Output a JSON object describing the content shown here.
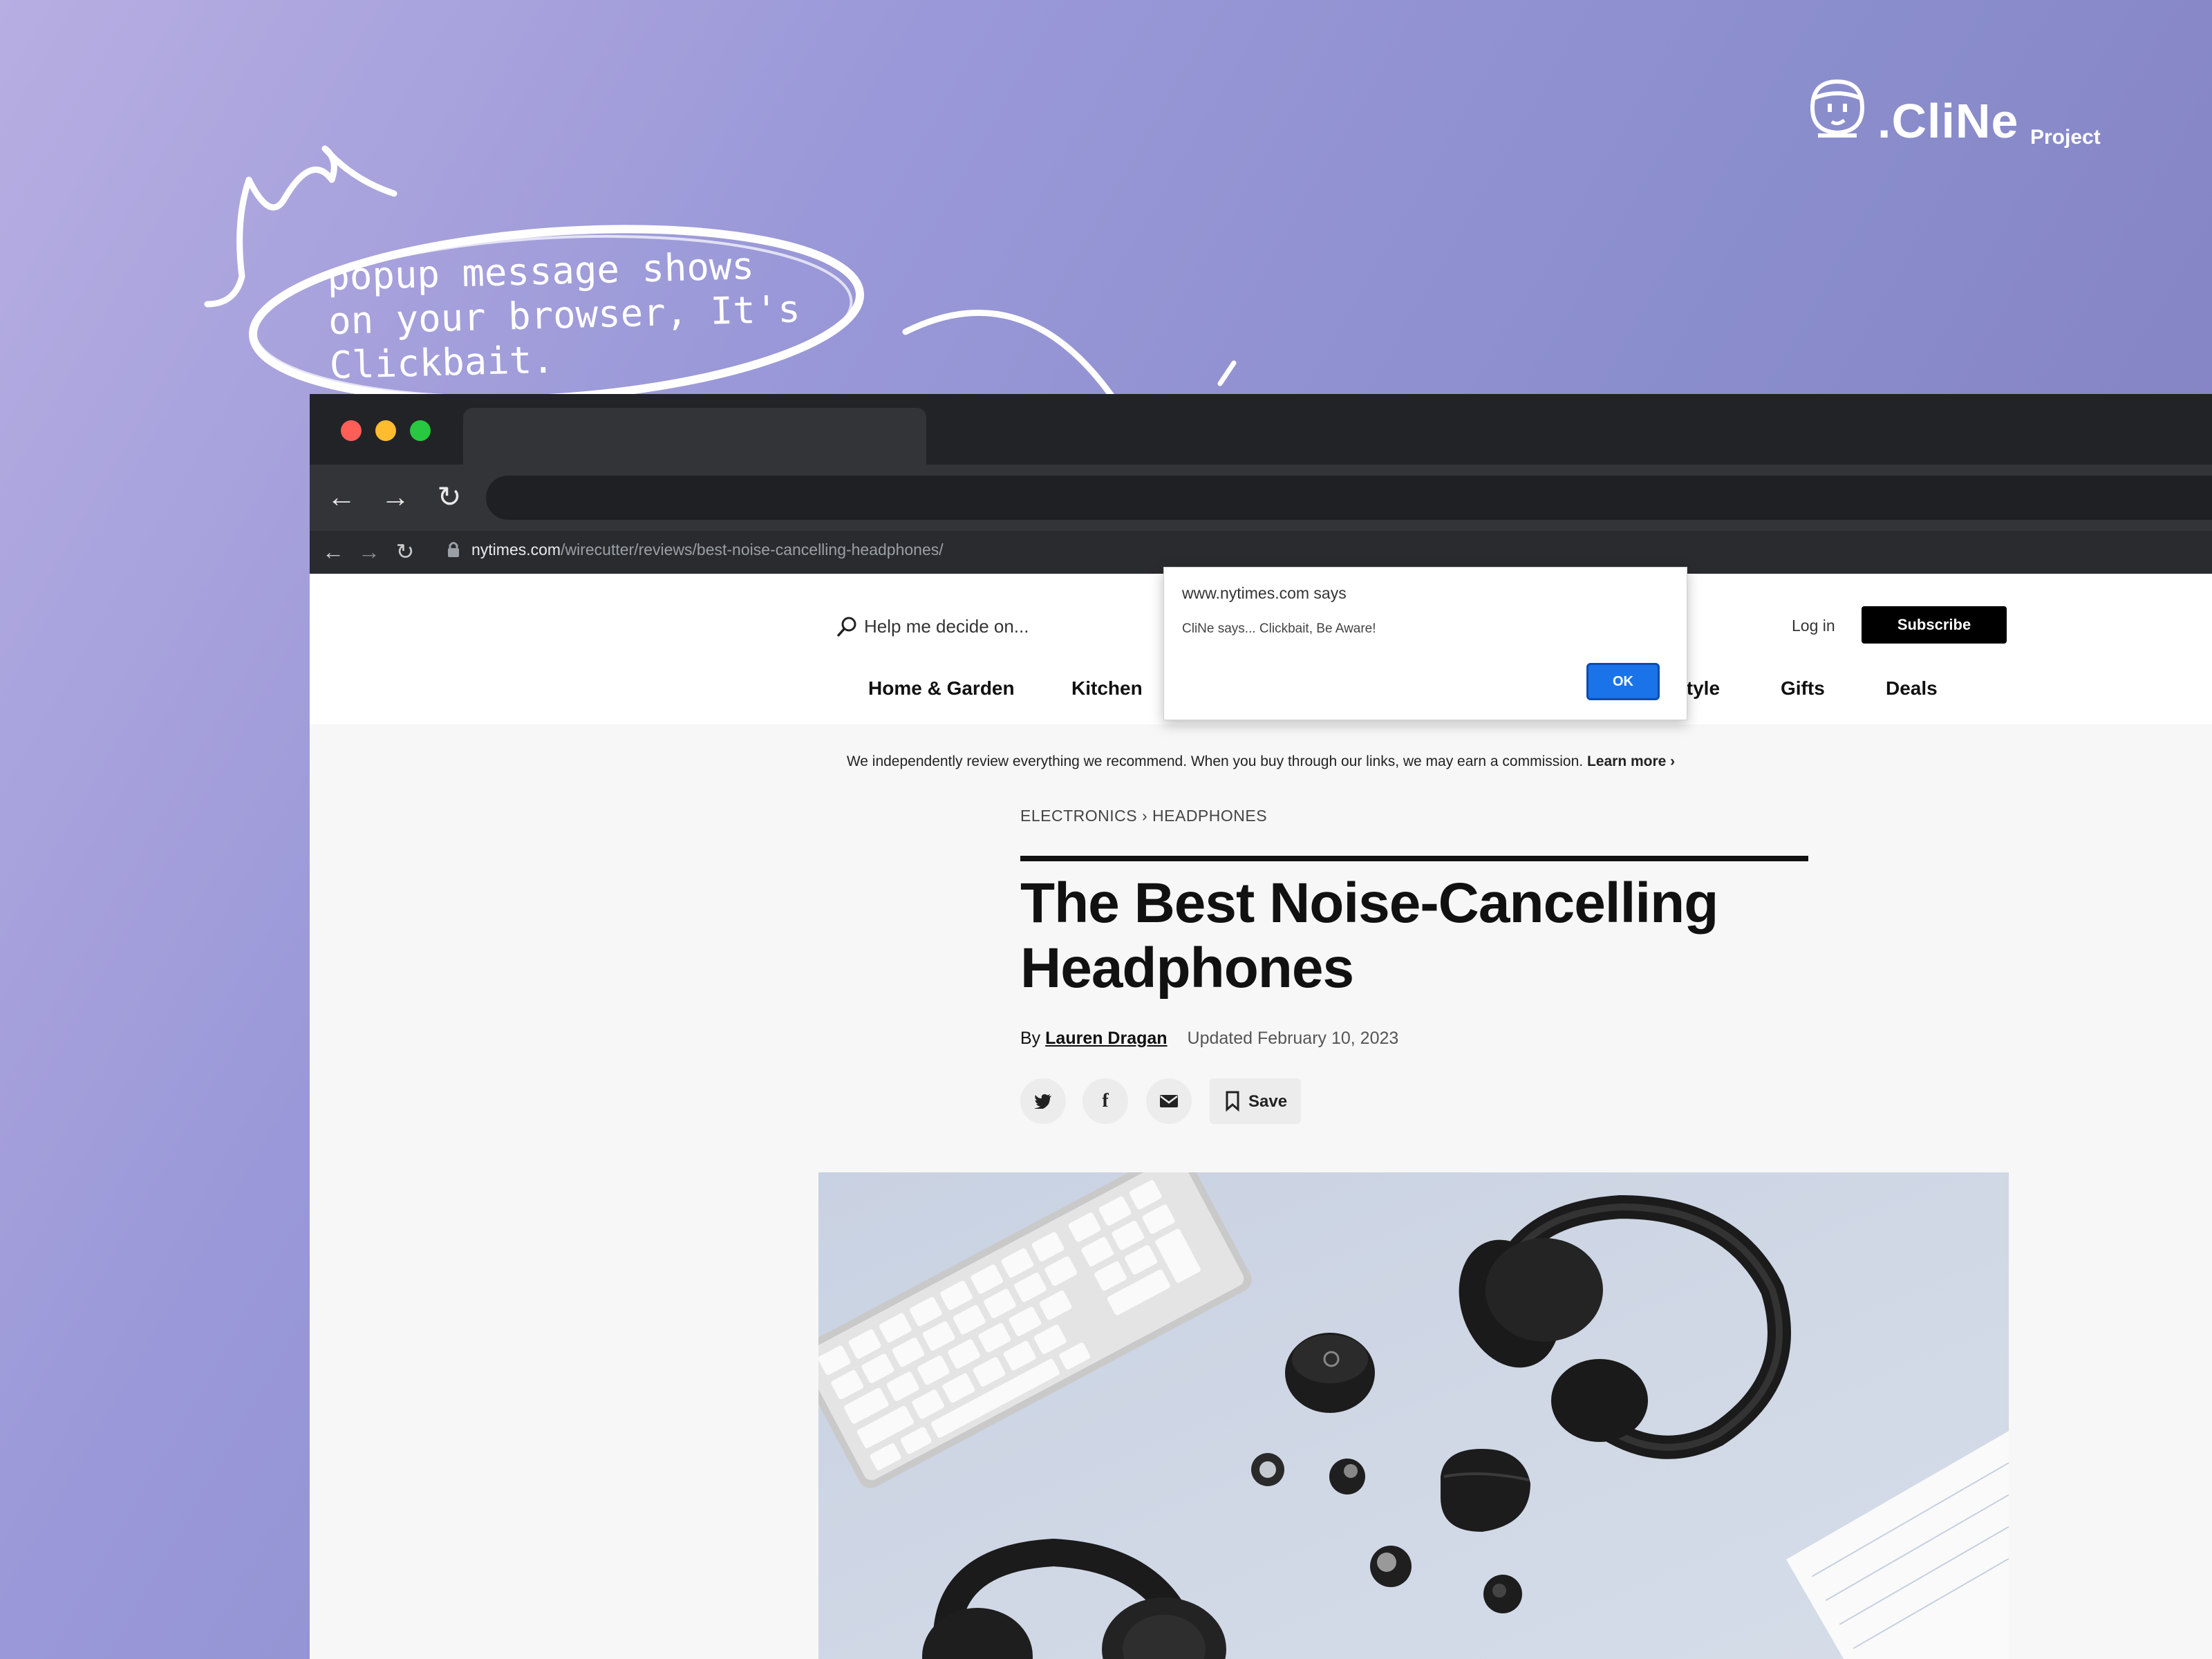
{
  "brand": {
    "name": ".CliNe",
    "sub": "Project"
  },
  "annotation": {
    "text": "popup message shows on your browser, It's Clickbait."
  },
  "browser": {
    "url_domain": "nytimes.com",
    "url_path": "/wirecutter/reviews/best-noise-cancelling-headphones/"
  },
  "site": {
    "search_placeholder": "Help me decide on...",
    "login": "Log in",
    "subscribe": "Subscribe",
    "categories": [
      "Home & Garden",
      "Kitchen",
      "Style",
      "Gifts",
      "Deals"
    ],
    "category_visible": [
      "Home & Garden",
      "Kitchen",
      "ityle",
      "Gifts",
      "Deals"
    ]
  },
  "article": {
    "disclaimer": "We independently review everything we recommend. When you buy through our links, we may earn a commission.",
    "learn_more": "Learn more ›",
    "breadcrumb": "ELECTRONICS › HEADPHONES",
    "headline": "The Best Noise-Cancelling Headphones",
    "by": "By",
    "author": "Lauren Dragan",
    "updated": "Updated February 10, 2023",
    "save": "Save"
  },
  "dialog": {
    "title": "www.nytimes.com says",
    "message": "CliNe says... Clickbait, Be Aware!",
    "ok": "OK"
  }
}
